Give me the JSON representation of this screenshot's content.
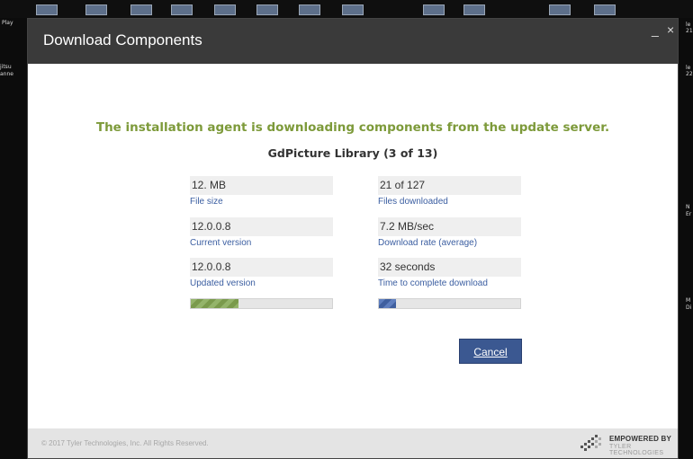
{
  "desktop": {
    "left_labels": [
      "Play",
      "jitsu",
      "anne"
    ],
    "right_labels": [
      "le",
      "21",
      "le",
      "22",
      "N",
      "Er",
      "M",
      "Di"
    ]
  },
  "dialog": {
    "title": "Download Components",
    "minimize": "_",
    "close": "×",
    "message": "The installation agent is downloading components from the update server.",
    "current_component": "GdPicture Library (3 of 13)",
    "left_stats": [
      {
        "value": "12. MB",
        "label": "File size"
      },
      {
        "value": "12.0.0.8",
        "label": "Current version"
      },
      {
        "value": "12.0.0.8",
        "label": "Updated version"
      }
    ],
    "right_stats": [
      {
        "value": "21 of 127",
        "label": "Files downloaded"
      },
      {
        "value": "7.2 MB/sec",
        "label": "Download rate (average)"
      },
      {
        "value": "32 seconds",
        "label": "Time to complete download"
      }
    ],
    "progress": {
      "component_fraction": 0.34,
      "overall_fraction": 0.12,
      "component_color": "#7a9a4c",
      "overall_color": "#3f5f9f"
    },
    "cancel_button": "Cancel",
    "footer": {
      "copyright": "© 2017 Tyler Technologies, Inc. All Rights Reserved.",
      "brand_line1": "EMPOWERED BY",
      "brand_line2": "TYLER TECHNOLOGIES"
    }
  }
}
